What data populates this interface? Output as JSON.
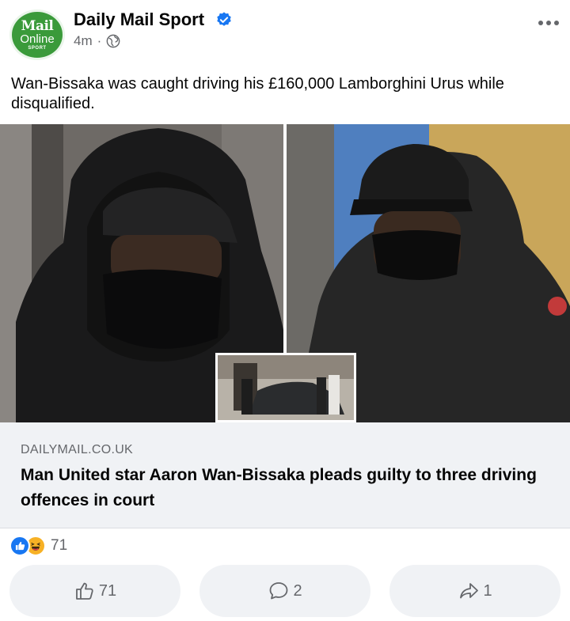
{
  "post": {
    "page_name": "Daily Mail Sport",
    "time": "4m",
    "separator": "·",
    "logo": {
      "line1": "Mail",
      "line2": "Online",
      "line3": "SPORT"
    },
    "caption": "Wan-Bissaka was caught driving his £160,000 Lamborghini Urus while disqualified.",
    "verified_icon": "verified-badge-icon",
    "privacy_icon": "globe-icon"
  },
  "link_preview": {
    "domain": "DAILYMAIL.CO.UK",
    "headline": "Man United star Aaron Wan-Bissaka pleads guilty to three driving offences in court"
  },
  "reactions": {
    "count": "71",
    "types": [
      "like",
      "haha"
    ]
  },
  "actions": {
    "like_count": "71",
    "comment_count": "2",
    "share_count": "1"
  },
  "colors": {
    "brand_blue": "#1877f2",
    "secondary_text": "#65676b",
    "button_bg": "#f0f2f5",
    "logo_green": "#3a9a3a"
  }
}
